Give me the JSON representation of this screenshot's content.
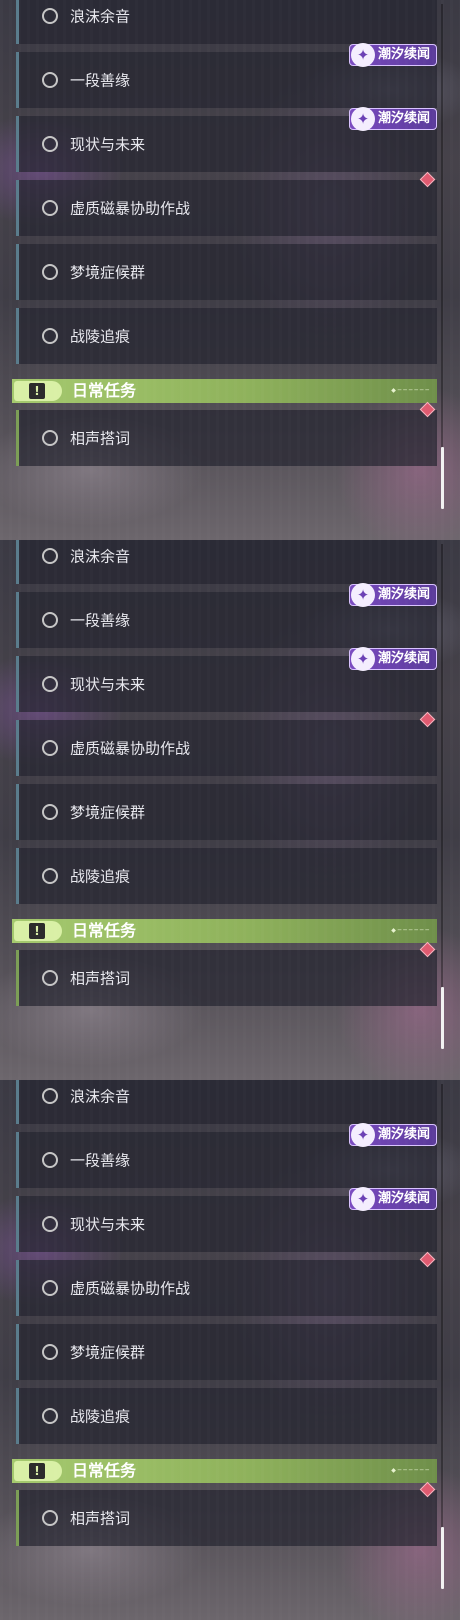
{
  "quest_list": {
    "items": [
      {
        "label": "浪沫余音",
        "marker": "none"
      },
      {
        "label": "一段善缘",
        "marker": "badge"
      },
      {
        "label": "现状与未来",
        "marker": "badge"
      },
      {
        "label": "虚质磁暴协助作战",
        "marker": "diamond"
      },
      {
        "label": "梦境症候群",
        "marker": "none"
      },
      {
        "label": "战陵追痕",
        "marker": "none"
      }
    ],
    "badge_text": "潮汐续闻",
    "badge_icon": "tidal-echo-icon",
    "diamond_color": "#e05a70",
    "accent_color": "#5a7c8c"
  },
  "daily_section": {
    "title": "日常任务",
    "icon": "exclamation-icon",
    "icon_glyph": "!",
    "header_color": "#a5c96e",
    "items": [
      {
        "label": "相声搭词",
        "marker": "diamond"
      }
    ]
  }
}
